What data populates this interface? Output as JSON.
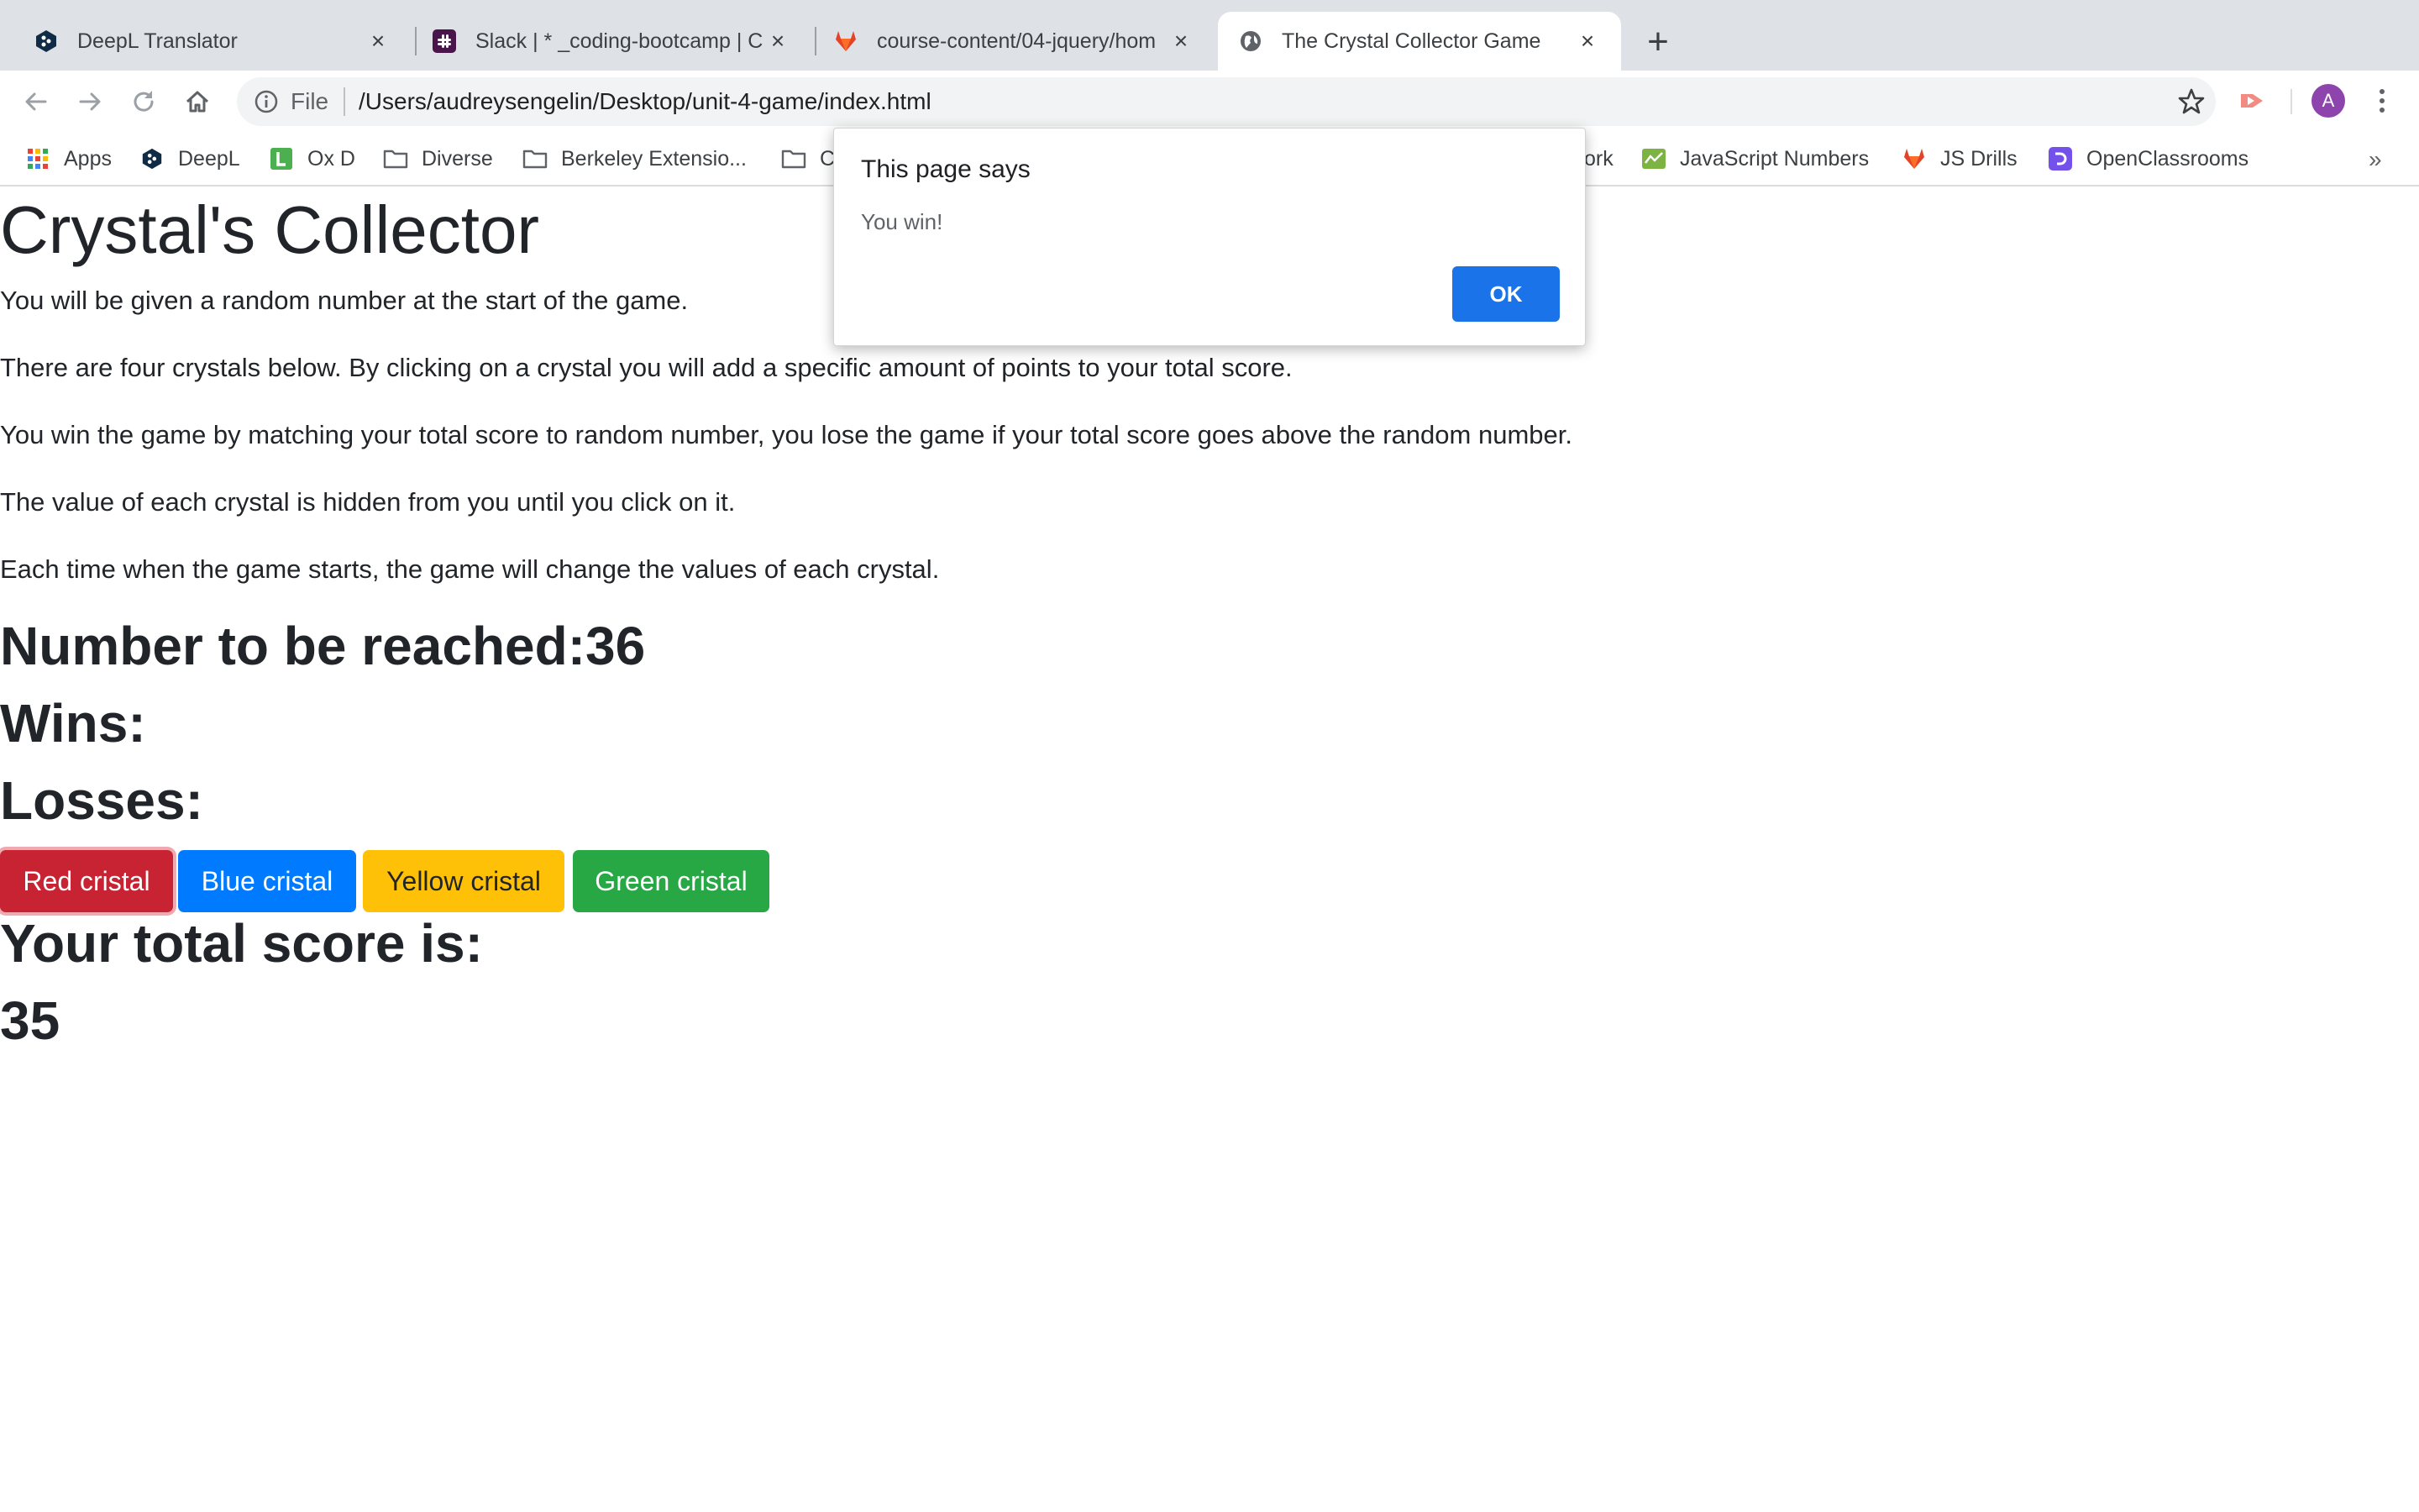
{
  "browser": {
    "tabs": [
      {
        "title": "DeepL Translator",
        "icon": "deepl-icon"
      },
      {
        "title": "Slack | * _coding-bootcamp | C",
        "icon": "slack-icon"
      },
      {
        "title": "course-content/04-jquery/hom",
        "icon": "gitlab-icon"
      },
      {
        "title": "The Crystal Collector Game",
        "icon": "globe-icon"
      }
    ],
    "address": {
      "scheme_label": "File",
      "url": "/Users/audreysengelin/Desktop/unit-4-game/index.html"
    },
    "profile_initial": "A",
    "bookmarks": [
      {
        "label": "Apps",
        "icon": "apps-grid-icon"
      },
      {
        "label": "DeepL",
        "icon": "deepl-icon"
      },
      {
        "label": "Ox D",
        "icon": "ox-d-icon"
      },
      {
        "label": "Diverse",
        "icon": "folder-icon"
      },
      {
        "label": "Berkeley Extensio...",
        "icon": "folder-icon"
      },
      {
        "label": "C",
        "icon": "folder-icon"
      },
      {
        "label": "ork",
        "icon": "none"
      },
      {
        "label": "JavaScript Numbers",
        "icon": "chart-icon"
      },
      {
        "label": "JS Drills",
        "icon": "gitlab-icon"
      },
      {
        "label": "OpenClassrooms",
        "icon": "openclassrooms-icon"
      }
    ],
    "bookmarks_more": "»"
  },
  "page": {
    "title": "Crystal's Collector",
    "paragraphs": [
      "You will be given a random number at the start of the game.",
      "There are four crystals below. By clicking on a crystal you will add a specific amount of points to your total score.",
      "You win the game by matching your total score to random number, you lose the game if your total score goes above the random number.",
      "The value of each crystal is hidden from you until you click on it.",
      "Each time when the game starts, the game will change the values of each crystal."
    ],
    "target_label": "Number to be reached:36",
    "wins_label": "Wins:",
    "losses_label": "Losses:",
    "buttons": [
      "Red cristal",
      "Blue cristal",
      "Yellow cristal",
      "Green cristal"
    ],
    "total_label": "Your total score is:",
    "total_value": "35"
  },
  "dialog": {
    "title": "This page says",
    "message": "You win!",
    "ok_label": "OK"
  },
  "colors": {
    "red_button": "#c82333",
    "blue_button": "#007bff",
    "yellow_button": "#ffc107",
    "green_button": "#28a745",
    "dialog_ok": "#1a73e8"
  }
}
